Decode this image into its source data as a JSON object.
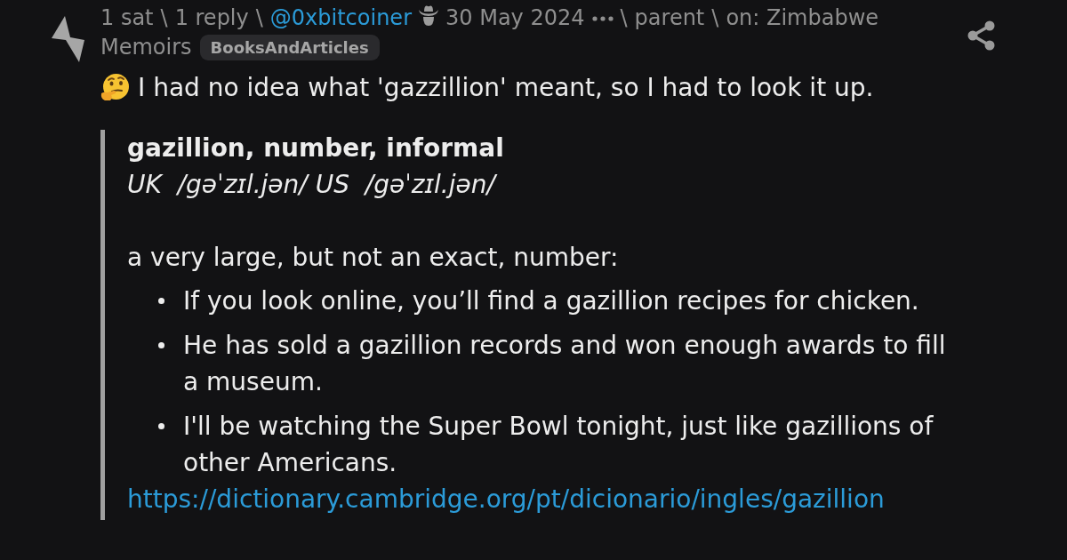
{
  "meta_lines": [
    [
      {
        "kind": "text",
        "text": "1 sat"
      },
      {
        "kind": "separator",
        "text": "\\"
      },
      {
        "kind": "link",
        "text": "1 reply"
      },
      {
        "kind": "separator",
        "text": "\\"
      },
      {
        "kind": "user",
        "text": "@0xbitcoiner"
      },
      {
        "kind": "link",
        "text": "30 May 2024"
      },
      {
        "kind": "menu"
      },
      {
        "kind": "separator",
        "text": "\\"
      },
      {
        "kind": "link",
        "text": "parent"
      },
      {
        "kind": "separator",
        "text": "\\"
      },
      {
        "kind": "link",
        "text": "on: Zimbabwe"
      }
    ],
    [
      {
        "kind": "link",
        "text": "Memoirs"
      },
      {
        "kind": "tag",
        "text": "BooksAndArticles"
      }
    ]
  ],
  "comment": {
    "text": "I had no idea what 'gazzillion' meant, so I had to look it up."
  },
  "quote": {
    "title": "gazillion, number, informal",
    "pronunciation": "UK  /gəˈzɪl.jən/ US  /gəˈzɪl.jən/",
    "definition": "a very large, but not an exact, number:",
    "examples": [
      "If you look online, you’ll find a gazillion recipes for chicken.",
      "He has sold a gazillion records and won enough awards to fill a museum.",
      "I'll be watching the Super Bowl tonight, just like gazillions of other Americans."
    ],
    "link": "https://dictionary.cambridge.org/pt/dicionario/ingles/gazillion"
  }
}
